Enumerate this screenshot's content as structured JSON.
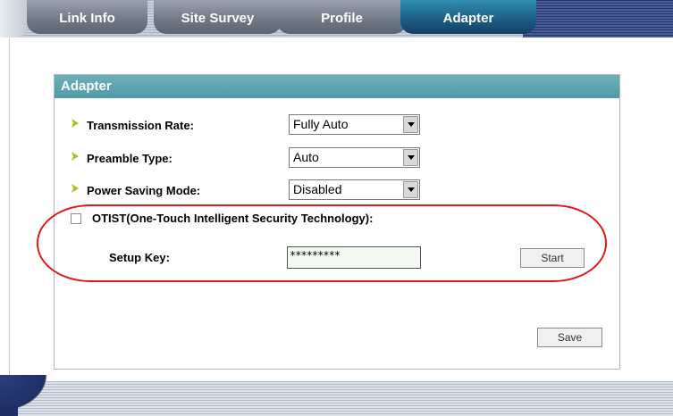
{
  "tabs": [
    {
      "label": "Link Info"
    },
    {
      "label": "Site Survey"
    },
    {
      "label": "Profile"
    },
    {
      "label": "Adapter",
      "active": true
    }
  ],
  "panel": {
    "title": "Adapter",
    "transmission_rate": {
      "label": "Transmission Rate:",
      "value": "Fully Auto"
    },
    "preamble_type": {
      "label": "Preamble Type:",
      "value": "Auto"
    },
    "power_saving_mode": {
      "label": "Power Saving Mode:",
      "value": "Disabled"
    },
    "otist": {
      "label": "OTIST(One-Touch Intelligent Security Technology):",
      "checked": false
    },
    "setup_key": {
      "label": "Setup Key:",
      "value": "*********"
    },
    "start_button": "Start",
    "save_button": "Save"
  },
  "colors": {
    "header_bg": "#5aa3ad",
    "active_tab": "#1c5f86",
    "bullet": "#9ec81e",
    "highlight_oval": "#e01a1a"
  }
}
